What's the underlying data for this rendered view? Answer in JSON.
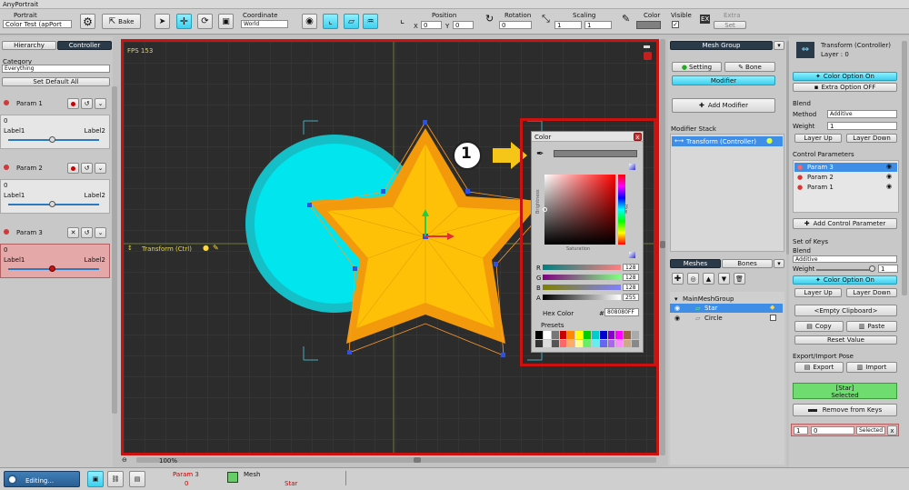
{
  "window_title": "AnyPortrait",
  "topbar": {
    "portrait_label": "Portrait",
    "portrait_value": "Color Test (apPort",
    "bake": "Bake",
    "coordinate_label": "Coordinate",
    "coordinate_value": "World",
    "position_label": "Position",
    "rotation_label": "Rotation",
    "scaling_label": "Scaling",
    "color_label": "Color",
    "visible_label": "Visible",
    "extra_label": "Extra",
    "extra_set": "Set",
    "x_label": "X",
    "y_label": "Y",
    "pos_x": "0",
    "pos_y": "0",
    "rot": "0",
    "scale_x": "1",
    "scale_y": "1"
  },
  "left": {
    "tab_hierarchy": "Hierarchy",
    "tab_controller": "Controller",
    "category_label": "Category",
    "category_value": "Everything",
    "set_default": "Set Default All",
    "params": [
      {
        "name": "Param 1",
        "value": "0",
        "label1": "Label1",
        "label2": "Label2"
      },
      {
        "name": "Param 2",
        "value": "0",
        "label1": "Label1",
        "label2": "Label2"
      },
      {
        "name": "Param 3",
        "value": "0",
        "label1": "Label1",
        "label2": "Label2"
      }
    ]
  },
  "viewport": {
    "fps": "FPS 153",
    "transform_label": "Transform (Ctrl)",
    "zoom": "100%",
    "callout": "1"
  },
  "color_dialog": {
    "title": "Color",
    "brightness": "Brightness",
    "hue": "Hue",
    "saturation": "Saturation",
    "r_label": "R",
    "g_label": "G",
    "b_label": "B",
    "a_label": "A",
    "r": "128",
    "g": "128",
    "b": "128",
    "a": "255",
    "hex_label": "Hex Color",
    "hex_hash": "#",
    "hex_value": "808080FF",
    "presets": "Presets",
    "close": "x"
  },
  "mid": {
    "mesh_group": "Mesh Group",
    "setting": "Setting",
    "bone": "Bone",
    "modifier": "Modifier",
    "add_modifier": "Add Modifier",
    "modifier_stack": "Modifier Stack",
    "stack_item": "Transform (Controller)",
    "meshes_tab": "Meshes",
    "bones_tab": "Bones",
    "tree_root": "MainMeshGroup",
    "tree_star": "Star",
    "tree_circle": "Circle"
  },
  "right": {
    "title": "Transform (Controller)",
    "layer": "Layer : 0",
    "color_option_on": "Color Option On",
    "extra_option_off": "Extra Option OFF",
    "blend": "Blend",
    "method_label": "Method",
    "method_value": "Additive",
    "weight_label": "Weight",
    "weight_value": "1",
    "layer_up": "Layer Up",
    "layer_down": "Layer Down",
    "control_parameters": "Control Parameters",
    "cp": [
      "Param 3",
      "Param 2",
      "Param 1"
    ],
    "add_control_parameter": "Add Control Parameter",
    "set_of_keys": "Set of Keys",
    "blend2": "Blend",
    "blend2_value": "Additive",
    "weight2_label": "Weight",
    "weight2_value": "1",
    "color_option_on2": "Color Option On",
    "layer_up2": "Layer Up",
    "layer_down2": "Layer Down",
    "empty_clipboard": "<Empty Clipboard>",
    "copy": "Copy",
    "paste": "Paste",
    "reset_value": "Reset Value",
    "export_import": "Export/Import Pose",
    "export": "Export",
    "import": "Import",
    "selected_name": "[Star]",
    "selected_text": "Selected",
    "remove_from_keys": "Remove from Keys",
    "sel_num1": "1",
    "sel_num2": "0",
    "sel_status": "Selected",
    "sel_x": "x"
  },
  "bottom": {
    "editing": "Editing...",
    "param": "Param 3",
    "param_val": "0",
    "mesh": "Mesh",
    "mesh_val": "Star"
  },
  "colors": {
    "accent": "#46d7f0",
    "red": "#cc1111",
    "viewport_bg": "#2c2c2c",
    "star": "#ffc107",
    "star_outline": "#f29a0c",
    "circle": "#00e5ee",
    "circle_ring": "#14bfc8"
  }
}
